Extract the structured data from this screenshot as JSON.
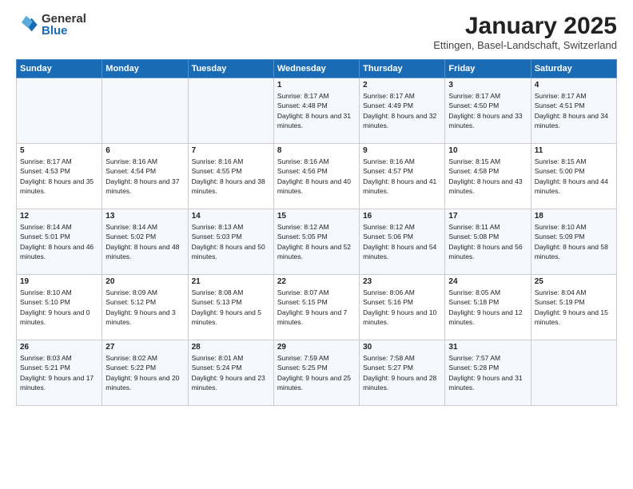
{
  "logo": {
    "general": "General",
    "blue": "Blue"
  },
  "title": "January 2025",
  "subtitle": "Ettingen, Basel-Landschaft, Switzerland",
  "weekdays": [
    "Sunday",
    "Monday",
    "Tuesday",
    "Wednesday",
    "Thursday",
    "Friday",
    "Saturday"
  ],
  "weeks": [
    [
      {
        "day": "",
        "info": ""
      },
      {
        "day": "",
        "info": ""
      },
      {
        "day": "",
        "info": ""
      },
      {
        "day": "1",
        "info": "Sunrise: 8:17 AM\nSunset: 4:48 PM\nDaylight: 8 hours and 31 minutes."
      },
      {
        "day": "2",
        "info": "Sunrise: 8:17 AM\nSunset: 4:49 PM\nDaylight: 8 hours and 32 minutes."
      },
      {
        "day": "3",
        "info": "Sunrise: 8:17 AM\nSunset: 4:50 PM\nDaylight: 8 hours and 33 minutes."
      },
      {
        "day": "4",
        "info": "Sunrise: 8:17 AM\nSunset: 4:51 PM\nDaylight: 8 hours and 34 minutes."
      }
    ],
    [
      {
        "day": "5",
        "info": "Sunrise: 8:17 AM\nSunset: 4:53 PM\nDaylight: 8 hours and 35 minutes."
      },
      {
        "day": "6",
        "info": "Sunrise: 8:16 AM\nSunset: 4:54 PM\nDaylight: 8 hours and 37 minutes."
      },
      {
        "day": "7",
        "info": "Sunrise: 8:16 AM\nSunset: 4:55 PM\nDaylight: 8 hours and 38 minutes."
      },
      {
        "day": "8",
        "info": "Sunrise: 8:16 AM\nSunset: 4:56 PM\nDaylight: 8 hours and 40 minutes."
      },
      {
        "day": "9",
        "info": "Sunrise: 8:16 AM\nSunset: 4:57 PM\nDaylight: 8 hours and 41 minutes."
      },
      {
        "day": "10",
        "info": "Sunrise: 8:15 AM\nSunset: 4:58 PM\nDaylight: 8 hours and 43 minutes."
      },
      {
        "day": "11",
        "info": "Sunrise: 8:15 AM\nSunset: 5:00 PM\nDaylight: 8 hours and 44 minutes."
      }
    ],
    [
      {
        "day": "12",
        "info": "Sunrise: 8:14 AM\nSunset: 5:01 PM\nDaylight: 8 hours and 46 minutes."
      },
      {
        "day": "13",
        "info": "Sunrise: 8:14 AM\nSunset: 5:02 PM\nDaylight: 8 hours and 48 minutes."
      },
      {
        "day": "14",
        "info": "Sunrise: 8:13 AM\nSunset: 5:03 PM\nDaylight: 8 hours and 50 minutes."
      },
      {
        "day": "15",
        "info": "Sunrise: 8:12 AM\nSunset: 5:05 PM\nDaylight: 8 hours and 52 minutes."
      },
      {
        "day": "16",
        "info": "Sunrise: 8:12 AM\nSunset: 5:06 PM\nDaylight: 8 hours and 54 minutes."
      },
      {
        "day": "17",
        "info": "Sunrise: 8:11 AM\nSunset: 5:08 PM\nDaylight: 8 hours and 56 minutes."
      },
      {
        "day": "18",
        "info": "Sunrise: 8:10 AM\nSunset: 5:09 PM\nDaylight: 8 hours and 58 minutes."
      }
    ],
    [
      {
        "day": "19",
        "info": "Sunrise: 8:10 AM\nSunset: 5:10 PM\nDaylight: 9 hours and 0 minutes."
      },
      {
        "day": "20",
        "info": "Sunrise: 8:09 AM\nSunset: 5:12 PM\nDaylight: 9 hours and 3 minutes."
      },
      {
        "day": "21",
        "info": "Sunrise: 8:08 AM\nSunset: 5:13 PM\nDaylight: 9 hours and 5 minutes."
      },
      {
        "day": "22",
        "info": "Sunrise: 8:07 AM\nSunset: 5:15 PM\nDaylight: 9 hours and 7 minutes."
      },
      {
        "day": "23",
        "info": "Sunrise: 8:06 AM\nSunset: 5:16 PM\nDaylight: 9 hours and 10 minutes."
      },
      {
        "day": "24",
        "info": "Sunrise: 8:05 AM\nSunset: 5:18 PM\nDaylight: 9 hours and 12 minutes."
      },
      {
        "day": "25",
        "info": "Sunrise: 8:04 AM\nSunset: 5:19 PM\nDaylight: 9 hours and 15 minutes."
      }
    ],
    [
      {
        "day": "26",
        "info": "Sunrise: 8:03 AM\nSunset: 5:21 PM\nDaylight: 9 hours and 17 minutes."
      },
      {
        "day": "27",
        "info": "Sunrise: 8:02 AM\nSunset: 5:22 PM\nDaylight: 9 hours and 20 minutes."
      },
      {
        "day": "28",
        "info": "Sunrise: 8:01 AM\nSunset: 5:24 PM\nDaylight: 9 hours and 23 minutes."
      },
      {
        "day": "29",
        "info": "Sunrise: 7:59 AM\nSunset: 5:25 PM\nDaylight: 9 hours and 25 minutes."
      },
      {
        "day": "30",
        "info": "Sunrise: 7:58 AM\nSunset: 5:27 PM\nDaylight: 9 hours and 28 minutes."
      },
      {
        "day": "31",
        "info": "Sunrise: 7:57 AM\nSunset: 5:28 PM\nDaylight: 9 hours and 31 minutes."
      },
      {
        "day": "",
        "info": ""
      }
    ]
  ]
}
